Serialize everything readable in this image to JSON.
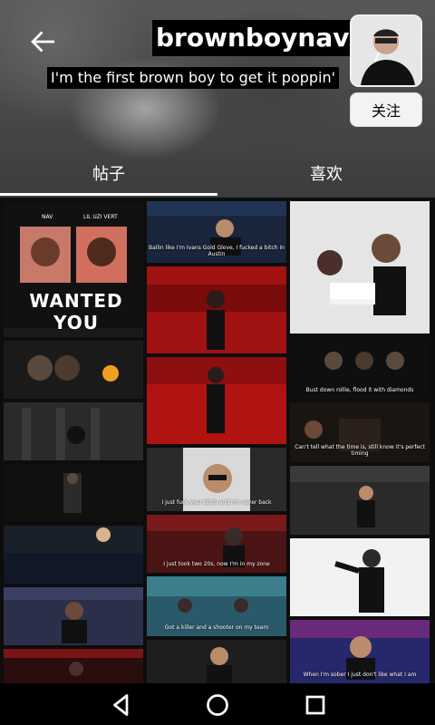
{
  "profile": {
    "username": "brownboynav",
    "bio": "I'm the first brown boy to get it poppin'",
    "follow_label": "关注"
  },
  "tabs": [
    {
      "label": "帖子",
      "active": true
    },
    {
      "label": "喜欢",
      "active": false
    }
  ],
  "grid": {
    "album": {
      "title": "WANTED YOU",
      "artist_left": "NAV",
      "artist_right": "LIL UZI VERT"
    },
    "subtitles": {
      "t1": "Ballin like I'm Ivans Gold Glove, I fucked a bitch in Austin",
      "t2": "Bust down rollie, flood it with diamonds",
      "t3": "Can't tell what the time is, still know it's perfect timing",
      "t4": "I just fuck your bitch and I'm never back",
      "t5": "I just took two 20s, now I'm in my zone",
      "t6": "Got a killer and a shooter on my team",
      "t7": "When I'm sober I just don't like what I am"
    }
  },
  "colors": {
    "accent_white": "#ffffff",
    "red_scene": "#b11212"
  },
  "icons": {
    "back": "back-arrow-icon",
    "nav_back": "triangle-back-icon",
    "nav_home": "circle-home-icon",
    "nav_recents": "square-recents-icon"
  }
}
